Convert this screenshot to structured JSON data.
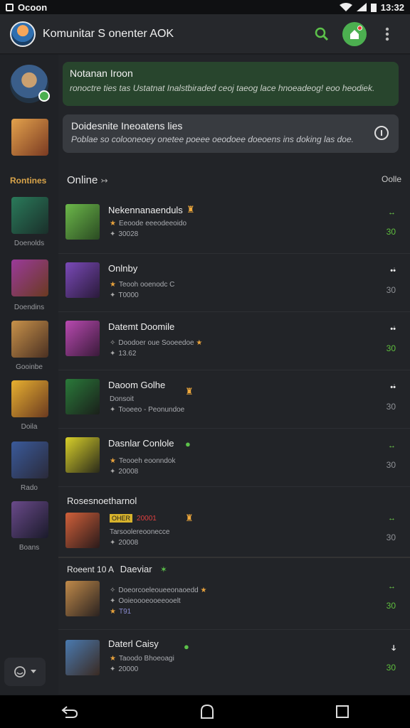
{
  "status_bar": {
    "left_text": "Ocoon",
    "time": "13:32"
  },
  "app_bar": {
    "title": "Komunitar S onenter AOK"
  },
  "banner_green": {
    "title": "Notanan Iroon",
    "subtitle": "ronoctre ties tas Ustatnat Inalstbiraded ceoj  taeog lace hnoeadeog! eoo heodiek."
  },
  "banner_gray": {
    "title": "Doidesnite Ineoatens lies",
    "subtitle": "Poblae so colooneoey onetee poeee oeodoee doeoens ins doking las doe."
  },
  "sidebar": {
    "heading": "Rontines",
    "labels": [
      "Doenolds",
      "Doendins",
      "Gooinbe",
      "Doila",
      "Rado",
      "Boans"
    ]
  },
  "list_header": {
    "title": "Online",
    "arrow": "↣",
    "right": "Oolle"
  },
  "rows": [
    {
      "name": "Nekennanaenduls",
      "line1": "Eeoode eeeodeeoido",
      "line2": "30028",
      "top": "↔",
      "bot": "30"
    },
    {
      "name": "Onlnby",
      "line1": "Teooh ooenodc C",
      "line2": "T0000",
      "top": "•͘•",
      "bot": "30"
    },
    {
      "name": "Datemt Doomile",
      "line1": "Doodoer oue Sooeedoe",
      "line2": "13.62",
      "top": "•͘•",
      "bot": "30"
    },
    {
      "name": "Daoom Golhe",
      "line1": "Donsoit",
      "line2": "Tooeeo - Peonundoe",
      "top": "•͘•",
      "bot": "30"
    },
    {
      "name": "Dasnlar Conlole",
      "line1": "Teooeh eoonndok",
      "line2": "20008",
      "top": "↔",
      "bot": "30"
    },
    {
      "section": "Rosesnoetharnol",
      "tag_yellow": "OHER",
      "tag_red": "20001",
      "line1": "Tarsoolereoonecce",
      "line2": "20008",
      "top": "↔",
      "bot": "30"
    }
  ],
  "section2": {
    "label_a": "Roeent 10 A",
    "label_b": "Daeviar"
  },
  "rows2": [
    {
      "line1": "Doeorcoeleoueeonaoedd",
      "line2": "Ooieoooeooeeooelt",
      "line3": "T91",
      "top": "↔",
      "bot": "30"
    },
    {
      "name": "Daterl Caisy",
      "line1": "Taoodo Bhoeoagi",
      "line2": "20000",
      "top": "ↆ",
      "bot": "30"
    }
  ]
}
